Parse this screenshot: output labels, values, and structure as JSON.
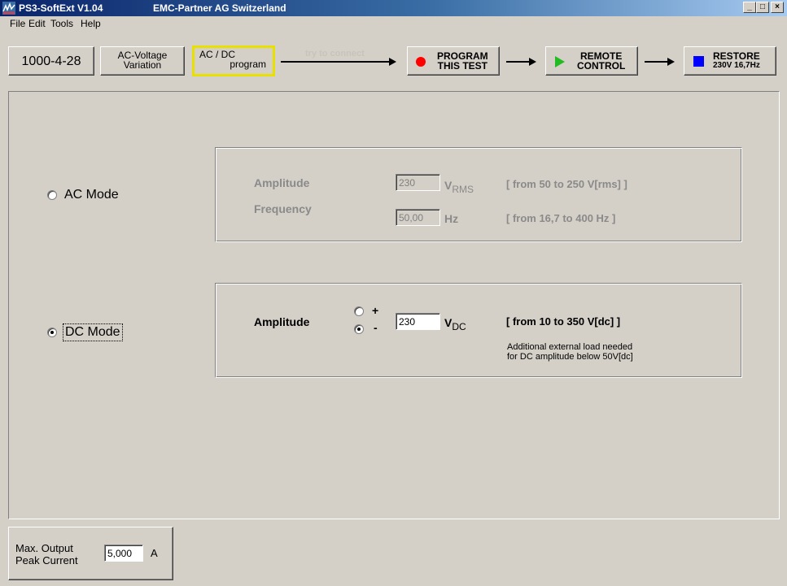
{
  "window": {
    "title": "PS3-SoftExt  V1.04",
    "company": "EMC-Partner AG Switzerland",
    "min_glyph": "_",
    "max_glyph": "□",
    "close_glyph": "×"
  },
  "menu": [
    "File",
    "Edit",
    "Tools",
    "Help"
  ],
  "toolbar": {
    "standard": "1000-4-28",
    "ac_voltage": [
      "AC-Voltage",
      "Variation"
    ],
    "acdc": [
      "AC / DC",
      "program"
    ],
    "connect_hint": "try to connect",
    "program": [
      "PROGRAM",
      "THIS TEST"
    ],
    "remote": [
      "REMOTE",
      "CONTROL"
    ],
    "restore": [
      "RESTORE",
      "230V 16,7Hz"
    ],
    "colors": {
      "program": "#ff0000",
      "remote": "#22bb22",
      "restore": "#0000ff",
      "acdc_border": "#e8e000"
    }
  },
  "ac_mode": {
    "label": "AC Mode",
    "selected": false,
    "amplitude_label": "Amplitude",
    "amplitude_value": "230",
    "amplitude_unit": "V",
    "amplitude_unit_sub": "RMS",
    "amplitude_range": "[ from 50 to 250 V[rms] ]",
    "frequency_label": "Frequency",
    "frequency_value": "50,00",
    "frequency_unit": "Hz",
    "frequency_range": "[ from 16,7 to 400 Hz ]"
  },
  "dc_mode": {
    "label": "DC Mode",
    "selected": true,
    "amplitude_label": "Amplitude",
    "polarity_plus": "+",
    "polarity_minus": "-",
    "polarity_selected": "-",
    "amplitude_value": "230",
    "amplitude_unit": "V",
    "amplitude_unit_sub": "DC",
    "amplitude_range": "[ from 10 to 350 V[dc] ]",
    "note_line1": "Additional external load needed",
    "note_line2": "for DC amplitude below 50V[dc]"
  },
  "current": {
    "label_line1": "Max. Output",
    "label_line2": "Peak Current",
    "value": "5,000",
    "unit": "A"
  }
}
